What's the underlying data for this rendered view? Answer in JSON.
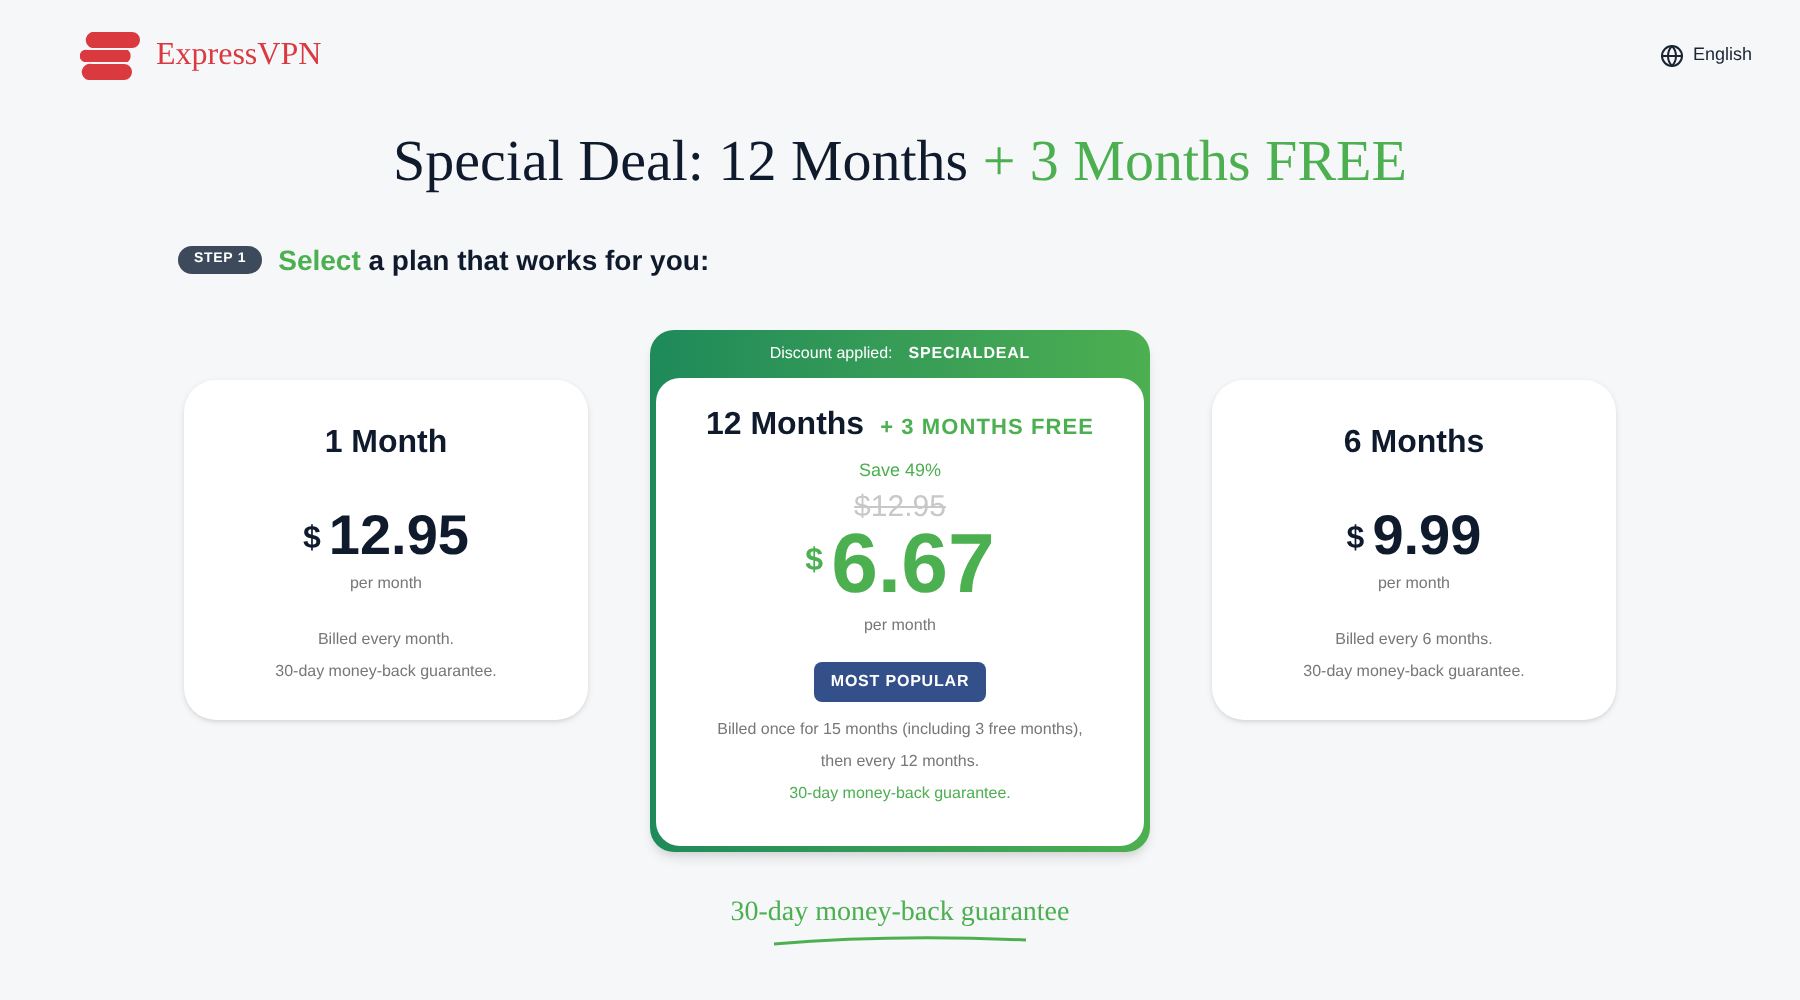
{
  "header": {
    "brand": "ExpressVPN",
    "language": "English"
  },
  "title": {
    "main": "Special Deal: 12 Months",
    "highlight": "+ 3 Months FREE"
  },
  "step": {
    "badge": "STEP 1",
    "highlight": "Select",
    "text": "a plan that works for you:"
  },
  "plans": [
    {
      "name": "1 Month",
      "selected": false,
      "currency": "$",
      "price": "12.95",
      "unit": "per month",
      "notes": [
        "Billed every month.",
        "30-day money-back guarantee."
      ]
    },
    {
      "name": "12 Months",
      "selected": true,
      "banner_label": "Discount applied:",
      "banner_code": "SPECIALDEAL",
      "bonus": "+ 3 MONTHS FREE",
      "save": "Save 49%",
      "old_price": "$12.95",
      "currency": "$",
      "price": "6.67",
      "unit": "per month",
      "badge": "MOST POPULAR",
      "notes": [
        "Billed once for 15 months (including 3 free months),",
        "then every 12 months."
      ],
      "guarantee": "30-day money-back guarantee."
    },
    {
      "name": "6 Months",
      "selected": false,
      "currency": "$",
      "price": "9.99",
      "unit": "per month",
      "notes": [
        "Billed every 6 months.",
        "30-day money-back guarantee."
      ]
    }
  ],
  "guarantee": "30-day money-back guarantee"
}
